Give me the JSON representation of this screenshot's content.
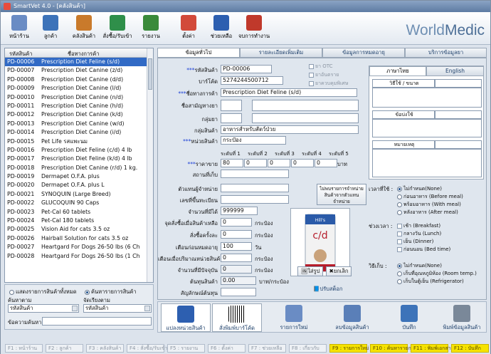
{
  "window": {
    "title": "SmartVet 4.0 - [คลังสินค้า]"
  },
  "brand": {
    "part1": "World",
    "part2": "Medic"
  },
  "toolbar": [
    {
      "label": "หน้าร้าน",
      "icon": "storefront-icon",
      "color": "#6a8cc4"
    },
    {
      "label": "ลูกค้า",
      "icon": "customers-icon",
      "color": "#3d73b9"
    },
    {
      "label": "คลังสินค้า",
      "icon": "warehouse-icon",
      "color": "#c97a2b"
    },
    {
      "label": "สั่งซื้อ/รับเข้า",
      "icon": "purchase-icon",
      "color": "#2f8f4a"
    },
    {
      "label": "รายงาน",
      "icon": "report-chart-icon",
      "color": "#3a8a3a"
    },
    {
      "label": "ตั้งค่า",
      "icon": "settings-icon",
      "color": "#d24a3a"
    },
    {
      "label": "ช่วยเหลือ",
      "icon": "help-icon",
      "color": "#2d5fb0"
    },
    {
      "label": "จบการทำงาน",
      "icon": "power-icon",
      "color": "#c0392b"
    }
  ],
  "product_list": {
    "col_code": "รหัสสินค้า",
    "col_name": "ชื่อทางการค้า",
    "rows": [
      {
        "code": "PD-00006",
        "name": "Prescription Diet Feline (s/d)"
      },
      {
        "code": "PD-00007",
        "name": "Prescription Diet Canine (z/d)"
      },
      {
        "code": "PD-00008",
        "name": "Prescription Diet Canine (d/d)"
      },
      {
        "code": "PD-00009",
        "name": "Prescription Diet Canine (l/d)"
      },
      {
        "code": "PD-00010",
        "name": "Prescription Diet Canine (n/d)"
      },
      {
        "code": "PD-00011",
        "name": "Prescription Diet Canine (h/d)"
      },
      {
        "code": "PD-00012",
        "name": "Prescription Diet Canine (k/d)"
      },
      {
        "code": "PD-00013",
        "name": "Prescription Diet Canine (w/d)"
      },
      {
        "code": "PD-00014",
        "name": "Prescription Diet Canine (i/d)"
      },
      {
        "code": "PD-00015",
        "name": "Pet Life รสแพะนม"
      },
      {
        "code": "PD-00016",
        "name": "Prescription Diet Feline (c/d) 4 lb"
      },
      {
        "code": "PD-00017",
        "name": "Prescription Diet Feline (k/d) 4 lb"
      },
      {
        "code": "PD-00018",
        "name": "Prescription Diet Canine (r/d) 1 kg."
      },
      {
        "code": "PD-00019",
        "name": "Dermapet O.F.A. plus"
      },
      {
        "code": "PD-00020",
        "name": "Dermapet O.F.A. plus L"
      },
      {
        "code": "PD-00021",
        "name": "SYNOQUIN (Large Breed)"
      },
      {
        "code": "PD-00022",
        "name": "GLUCOQUIN 90 Caps"
      },
      {
        "code": "PD-00023",
        "name": "Pet-Cal 60 tablets"
      },
      {
        "code": "PD-00024",
        "name": "Pet-Cal 180 tablets"
      },
      {
        "code": "PD-00025",
        "name": "Vision Aid for cats  3.5 oz"
      },
      {
        "code": "PD-00026",
        "name": "Hairball Solution for cats 3.5 oz"
      },
      {
        "code": "PD-00027",
        "name": "Heartgard For Dogs 26-50 lbs (6 Ch"
      },
      {
        "code": "PD-00028",
        "name": "Heartgard For Dogs 26-50 lbs (1 Ch"
      }
    ]
  },
  "filter": {
    "show_all": "แสดงรายการสินค้าทั้งหมด",
    "search_items": "ค้นหารายการสินค้า",
    "search_by_label": "ค้นหาตาม",
    "search_by_value": "รหัสสินค้า",
    "sort_by_label": "จัดเรียงตาม",
    "sort_by_value": "รหัสสินค้า",
    "search_text_label": "ข้อความค้นหา",
    "search_text_value": ""
  },
  "tabs": [
    "ข้อมูลทั่วไป",
    "รายละเอียดเพิ่มเติม",
    "ข้อมูลการหมดอายุ",
    "บริการข้อมูลยา"
  ],
  "form": {
    "code_label": "รหัสสินค้า",
    "code_value": "PD-00006",
    "barcode_label": "บาร์โค้ด",
    "barcode_value": "5274244500712",
    "trade_name_label": "ชื่อทางการค้า",
    "trade_name_value": "Prescription Diet Feline (s/d)",
    "generic_label": "ชื่อสามัญทางยา",
    "group_label": "กลุ่มยา",
    "product_group_label": "กลุ่มสินค้า",
    "product_group_value": "อาหารสำหรับสัตว์ป่วย",
    "unit_label": "หน่วยสินค้า",
    "unit_value": "กระป๋อง",
    "otc_label": "ยา OTC",
    "dangerous_label": "ยาอันตราย",
    "controlled_label": "ยาควบคุมพิเศษ",
    "price_levels": [
      "ระดับที่ 1",
      "ระดับที่ 2",
      "ระดับที่ 3",
      "ระดับที่ 4",
      "ระดับที่ 5"
    ],
    "price_label": "ราคาขาย",
    "prices": [
      "80",
      "0",
      "0",
      "0",
      "0"
    ],
    "price_unit": "บาท",
    "location_label": "สถานที่เก็บ",
    "distributor_label": "ตัวแทนผู้จำหน่าย",
    "reg_no_label": "เลขที่ขึ้นทะเบียน",
    "distributor_note": "ไม่พบรายการจำหน่ายสินค้าจากตัวแทนจำหน่าย",
    "stock_label": "จำนวนที่มีได้",
    "stock_value": "999999",
    "reorder_label": "จุดสั่งซื้อเมื่อสินค้าเหลือ",
    "reorder_value": "0",
    "order_qty_label": "สั่งซื้อครั้งละ",
    "order_qty_value": "0",
    "expiry_alert_label": "เตือนก่อนหมดอายุ",
    "expiry_alert_value": "100",
    "expiry_alert_unit": "วัน",
    "low_stock_label": "เตือนเมื่อปริมาณหน่วยสินค้า",
    "low_stock_value": "0",
    "current_qty_label": "จำนวนที่มีปัจจุบัน",
    "current_qty_value": "0",
    "cost_label": "ต้นทุนสินค้า",
    "cost_value": "0.00",
    "cost_unit": "บาท/กระป๋อง",
    "symbol_label": "สัญลักษณ์ต้นทุน",
    "unit_word": "กระป๋อง",
    "image_add": "ใส่รูป",
    "image_remove": "ยกเลิก",
    "adjust_stock": "ปรับสต็อก"
  },
  "right_panel": {
    "tab_thai": "ภาษาไทย",
    "tab_english": "English",
    "indication_label": "วิธีใช้ / ขนาด",
    "contraindication_label": "ข้อบ่งใช้",
    "note_label": "หมายเหตุ",
    "time_label": "เวลาที่ใช้ :",
    "time_options": [
      "ไม่กำหนด(None)",
      "ก่อนอาหาร (Before meal)",
      "พร้อมอาหาร (With meal)",
      "หลังอาหาร (After meal)"
    ],
    "period_label": "ช่วงเวลา :",
    "period_options": [
      "เช้า (Breakfast)",
      "กลางวัน (Lunch)",
      "เย็น (Dinner)",
      "ก่อนนอน (Bed time)"
    ],
    "storage_label": "วิธีเก็บ :",
    "storage_options": [
      "ไม่กำหนด(None)",
      "เก็บที่อุณหภูมิห้อง (Room temp.)",
      "เก็บในตู้เย็น (Refrigerator)"
    ]
  },
  "bottom_buttons": [
    {
      "label": "แปลงหน่วยสินค้า",
      "icon": "convert-unit-icon"
    },
    {
      "label": "สั่งพิมพ์บาร์โค้ด",
      "icon": "barcode-icon"
    },
    {
      "label": "รายการใหม่",
      "icon": "new-document-icon"
    },
    {
      "label": "ลบข้อมูลสินค้า",
      "icon": "delete-icon"
    },
    {
      "label": "บันทึก",
      "icon": "save-icon"
    },
    {
      "label": "พิมพ์ข้อมูลสินค้า",
      "icon": "printer-icon"
    }
  ],
  "status_keys": [
    {
      "label": "F1 : หน้าร้าน",
      "hl": false
    },
    {
      "label": "F2 : ลูกค้า",
      "hl": false
    },
    {
      "label": "F3 : คลังสินค้า",
      "hl": false
    },
    {
      "label": "F4 : สั่งซื้อ/รับเข้า",
      "hl": false
    },
    {
      "label": "F5 : รายงาน",
      "hl": false
    },
    {
      "label": "F6 : ตั้งค่า",
      "hl": false
    },
    {
      "label": "F7 : ช่วยเหลือ",
      "hl": false
    },
    {
      "label": "F8 : เกี่ยวกับ",
      "hl": false
    },
    {
      "label": "F9 : รายการใหม่",
      "hl": true
    },
    {
      "label": "F10 : ค้นหารายการ",
      "hl": true
    },
    {
      "label": "F11 : พิมพ์เอกสาร",
      "hl": true
    },
    {
      "label": "F12 : บันทึก",
      "hl": true
    }
  ],
  "colors": {
    "selection": "#316ac5",
    "brand": "#6f8fb3",
    "required_star": "#1b3fd6",
    "fkey_highlight": "#f6e300"
  }
}
